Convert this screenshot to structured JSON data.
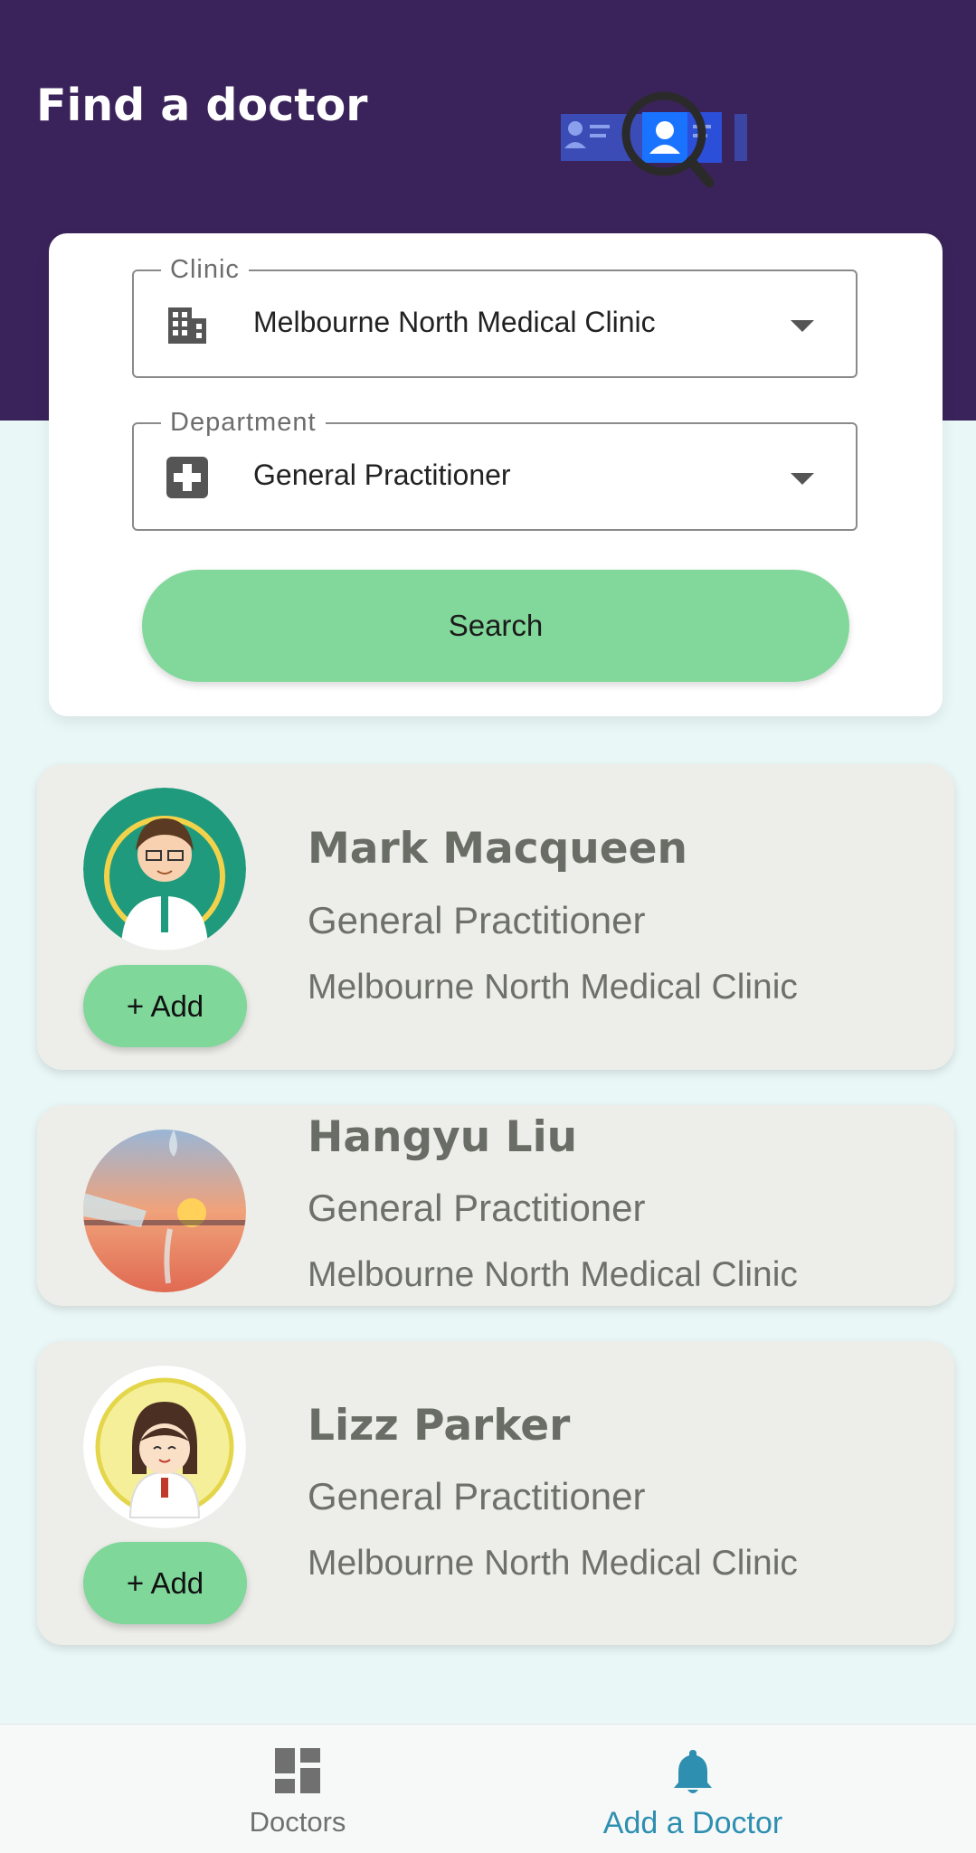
{
  "header": {
    "title": "Find a doctor"
  },
  "search_form": {
    "clinic": {
      "label": "Clinic",
      "value": "Melbourne North Medical Clinic",
      "icon": "building-icon"
    },
    "department": {
      "label": "Department",
      "value": "General Practitioner",
      "icon": "medical-cross-icon"
    },
    "search_label": "Search"
  },
  "doctors": [
    {
      "name": "Mark Macqueen",
      "department": "General Practitioner",
      "clinic": "Melbourne North Medical Clinic",
      "action": "+ Add"
    },
    {
      "name": "Hangyu Liu",
      "department": "General Practitioner",
      "clinic": "Melbourne North Medical Clinic"
    },
    {
      "name": "Lizz Parker",
      "department": "General Practitioner",
      "clinic": "Melbourne North Medical Clinic",
      "action": "+ Add"
    }
  ],
  "bottom_nav": {
    "items": [
      {
        "label": "Doctors",
        "icon": "dashboard-icon",
        "active": false
      },
      {
        "label": "Add a Doctor",
        "icon": "bell-icon",
        "active": true
      }
    ]
  },
  "colors": {
    "header_bg": "#3a235a",
    "accent_green": "#82d89b",
    "active_nav": "#2f8fb0",
    "card_bg": "#edeee9"
  }
}
